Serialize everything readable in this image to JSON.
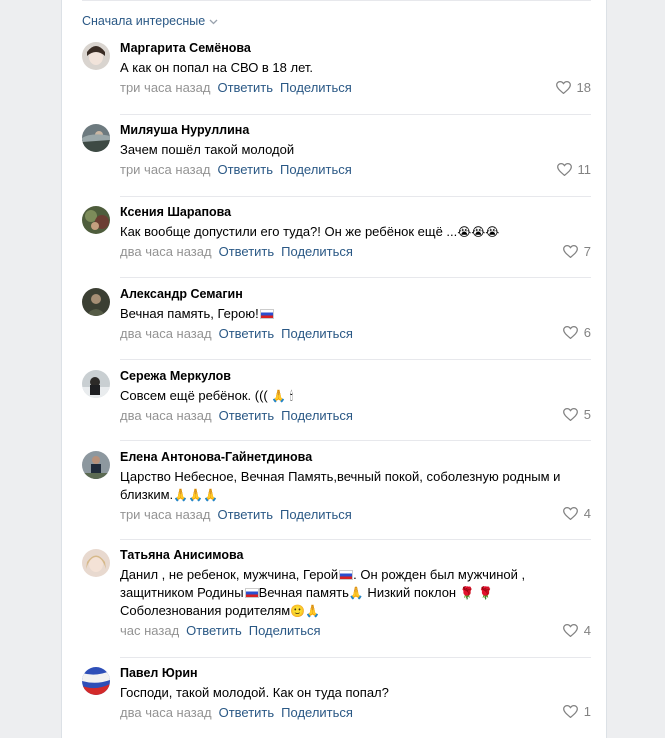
{
  "sort_label": "Сначала интересные",
  "actions": {
    "reply": "Ответить",
    "share": "Поделиться"
  },
  "comments": [
    {
      "author": "Маргарита Семёнова",
      "text": "А как он попал на СВО в 18 лет.",
      "time": "три часа назад",
      "likes": "18"
    },
    {
      "author": "Миляуша Нуруллина",
      "text": "Зачем пошёл такой молодой",
      "time": "три часа назад",
      "likes": "11"
    },
    {
      "author": "Ксения Шарапова",
      "text": "Как вообще допустили его туда?! Он же ребёнок ещё ...",
      "emoji": "😭😭😭",
      "time": "два часа назад",
      "likes": "7"
    },
    {
      "author": "Александр Семагин",
      "text": "Вечная память, Герою!",
      "time": "два часа назад",
      "likes": "6"
    },
    {
      "author": "Сережа Меркулов",
      "text": "Совсем ещё ребёнок. (((",
      "emoji": "🙏 🕯",
      "time": "два часа назад",
      "likes": "5"
    },
    {
      "author": "Елена Антонова-Гайнетдинова",
      "text_line1": "Царство Небесное, Вечная Память,вечный покой, соболезную родным и",
      "text_line2": "близким.",
      "emoji": "🙏🙏🙏",
      "time": "три часа назад",
      "likes": "4"
    },
    {
      "author": "Татьяна Анисимова",
      "text_line1": "Данил , не ребенок, мужчина, Герой",
      "text_line1b": ". Он рожден был мужчиной ,",
      "text_line2": "защитником Родины",
      "text_line2b": "Вечная память",
      "text_line2c": " Низкий поклон",
      "text_line3": "Соболезнования родителям",
      "time": "час назад",
      "likes": "4"
    },
    {
      "author": "Павел Юрин",
      "text": "Господи, такой молодой. Как он туда попал?",
      "time": "два часа назад",
      "likes": "1"
    }
  ],
  "colors": {
    "link": "#2a5885",
    "meta": "#939393",
    "background": "#edeef0"
  }
}
